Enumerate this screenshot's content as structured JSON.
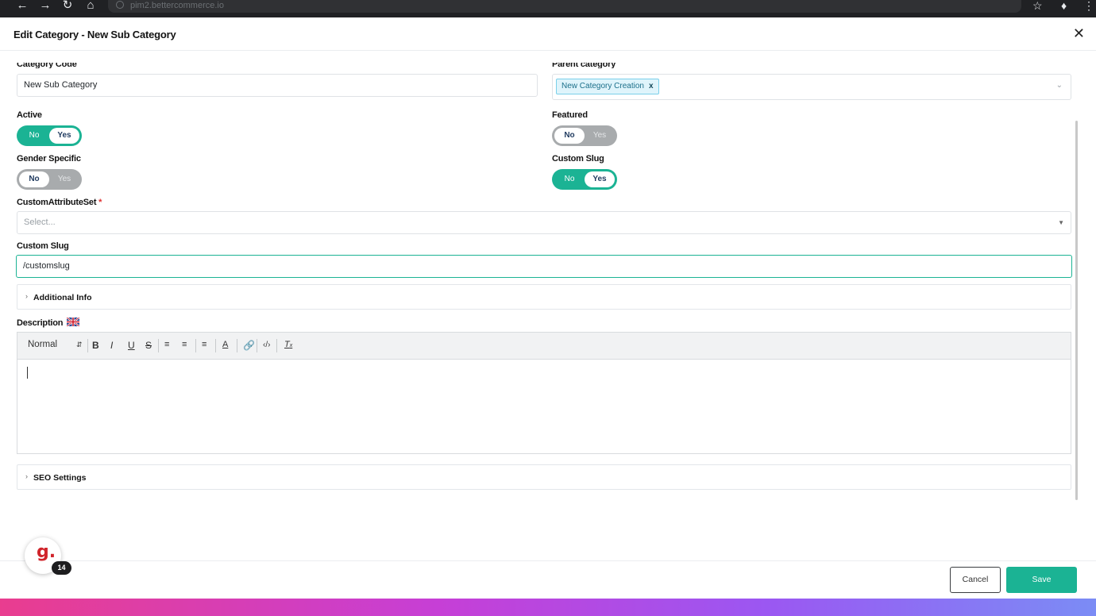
{
  "browser": {
    "url": "pim2.bettercommerce.io"
  },
  "modal": {
    "title": "Edit Category - New Sub Category",
    "close_icon": "close-icon"
  },
  "form": {
    "category_code": {
      "label": "Category Code",
      "value": "New Sub Category"
    },
    "parent_category": {
      "label": "Parent category",
      "chip": "New Category Creation",
      "chip_remove": "x"
    },
    "active": {
      "label": "Active",
      "no": "No",
      "yes": "Yes",
      "selected": "Yes"
    },
    "featured": {
      "label": "Featured",
      "no": "No",
      "yes": "Yes",
      "selected": "No"
    },
    "gender_specific": {
      "label": "Gender Specific",
      "no": "No",
      "yes": "Yes",
      "selected": "No"
    },
    "custom_slug_toggle": {
      "label": "Custom Slug",
      "no": "No",
      "yes": "Yes",
      "selected": "Yes"
    },
    "custom_attribute_set": {
      "label": "CustomAttributeSet",
      "required": "*",
      "placeholder": "Select..."
    },
    "custom_slug": {
      "label": "Custom Slug",
      "value": "/customslug"
    },
    "additional_info": {
      "label": "Additional Info"
    },
    "description": {
      "label": "Description",
      "toolbar": {
        "format": "Normal",
        "bold": "B",
        "italic": "I",
        "underline": "U",
        "strike": "S",
        "code": "‹/›"
      }
    },
    "seo_settings": {
      "label": "SEO Settings"
    }
  },
  "footer": {
    "cancel_label": "Cancel",
    "save_label": "Save",
    "helper_letter": "g.",
    "helper_badge": "14"
  },
  "colors": {
    "accent": "#1bb394",
    "toggle_off": "#a8abad",
    "chip_bg": "#dff4fb"
  }
}
